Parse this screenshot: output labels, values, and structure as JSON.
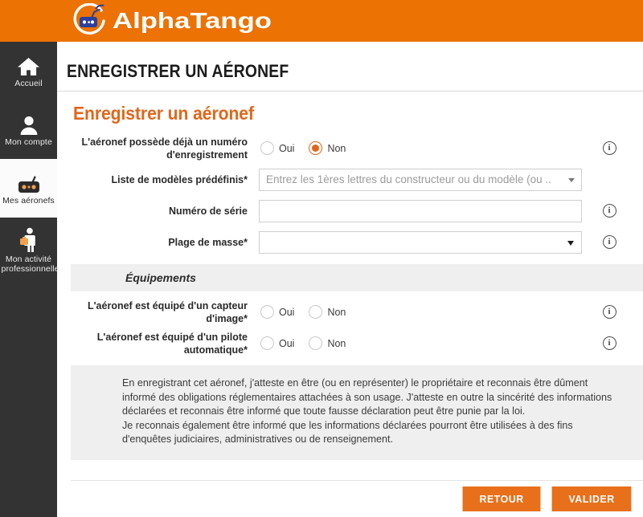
{
  "brand": {
    "name": "AlphaTango",
    "name_part1": "Alpha",
    "name_part2": "Tango",
    "logo_icon": "drone-remote-controller-icon",
    "orange": "#eb7203",
    "logo_blue": "#2b3f9e"
  },
  "sidebar": {
    "items": [
      {
        "label": "Accueil",
        "icon": "home-icon",
        "active": false
      },
      {
        "label": "Mon compte",
        "icon": "user-icon",
        "active": false
      },
      {
        "label": "Mes aéronefs",
        "icon": "drone-remote-controller-icon",
        "active": true
      },
      {
        "label": "Mon activité professionnelle",
        "icon": "briefcase-person-icon",
        "active": false
      }
    ]
  },
  "header": {
    "title": "ENREGISTRER UN AÉRONEF"
  },
  "main": {
    "section_title": "Enregistrer un aéronef",
    "rows": [
      {
        "label": "L'aéronef possède déjà un numéro d'enregistrement",
        "type": "radio",
        "options": [
          {
            "label": "Oui",
            "checked": false
          },
          {
            "label": "Non",
            "checked": true
          }
        ],
        "info": true
      },
      {
        "label": "Liste de modèles prédéfinis*",
        "type": "autocomplete",
        "value": "",
        "placeholder": "Entrez les 1ères lettres du constructeur ou du modèle (ou ..",
        "info": false
      },
      {
        "label": "Numéro de série",
        "type": "text",
        "value": "",
        "placeholder": "",
        "info": true
      },
      {
        "label": "Plage de masse*",
        "type": "select",
        "value": "",
        "info": true
      }
    ],
    "equipment_band": "Équipements",
    "equipment_rows": [
      {
        "label": "L'aéronef est équipé d'un capteur d'image*",
        "type": "radio",
        "options": [
          {
            "label": "Oui",
            "checked": false
          },
          {
            "label": "Non",
            "checked": false
          }
        ],
        "info": true
      },
      {
        "label": "L'aéronef est équipé d'un pilote automatique*",
        "type": "radio",
        "options": [
          {
            "label": "Oui",
            "checked": false
          },
          {
            "label": "Non",
            "checked": false
          }
        ],
        "info": true
      }
    ],
    "disclaimer_p1": "En enregistrant cet aéronef, j'atteste en être (ou en représenter) le propriétaire et reconnais être dûment informé des obligations réglementaires attachées à son usage. J'atteste en outre la sincérité des informations déclarées et reconnais être informé que toute fausse déclaration peut être punie par la loi.",
    "disclaimer_p2": "Je reconnais également être informé que les informations déclarées pourront être utilisées à des fins d'enquêtes judiciaires, administratives ou de renseignement."
  },
  "footer": {
    "back_label": "RETOUR",
    "submit_label": "VALIDER",
    "button_color": "#e8701a"
  },
  "icons": {
    "info": "i"
  }
}
